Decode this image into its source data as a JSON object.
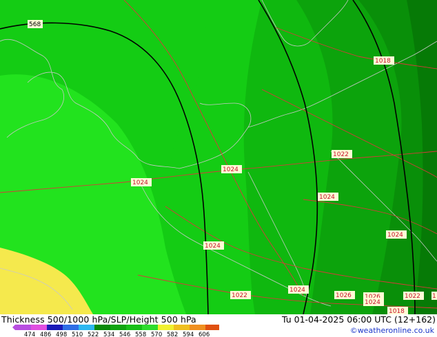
{
  "title": "Thickness 500/1000 hPa/SLP/Height 500 hPa",
  "datetime": "Tu 01-04-2025 06:00 UTC (12+162)",
  "credit": "©weatheronline.co.uk",
  "colors": {
    "yellow": "#f5e94d",
    "bright_green": "#22e31e",
    "green_1": "#14cc14",
    "green_2": "#0fb80f",
    "green_3": "#0ca30c",
    "green_4": "#098f09",
    "green_5": "#067a06",
    "isobar": "#d83a3a",
    "coast": "#c8c8c8",
    "height_contour": "#000000"
  },
  "legend": {
    "ticks": [
      "474",
      "486",
      "498",
      "510",
      "522",
      "534",
      "546",
      "558",
      "570",
      "582",
      "594",
      "606"
    ],
    "colors": [
      "#b84ee0",
      "#e04ee0",
      "#1a1ab8",
      "#2e6ee6",
      "#2eb8f0",
      "#0a8a0a",
      "#10a410",
      "#18c018",
      "#2edc2e",
      "#f0f030",
      "#f0c020",
      "#f09020",
      "#e05010"
    ]
  },
  "map": {
    "height_label": "568",
    "pressure_labels": [
      {
        "text": "1018"
      },
      {
        "text": "1022"
      },
      {
        "text": "1024"
      },
      {
        "text": "1024"
      },
      {
        "text": "1024"
      },
      {
        "text": "1024"
      },
      {
        "text": "1024"
      },
      {
        "text": "1024"
      },
      {
        "text": "1022"
      },
      {
        "text": "1026"
      },
      {
        "text": "1026"
      },
      {
        "text": "1024"
      },
      {
        "text": "1022"
      },
      {
        "text": "1018"
      },
      {
        "text": "1"
      }
    ]
  }
}
